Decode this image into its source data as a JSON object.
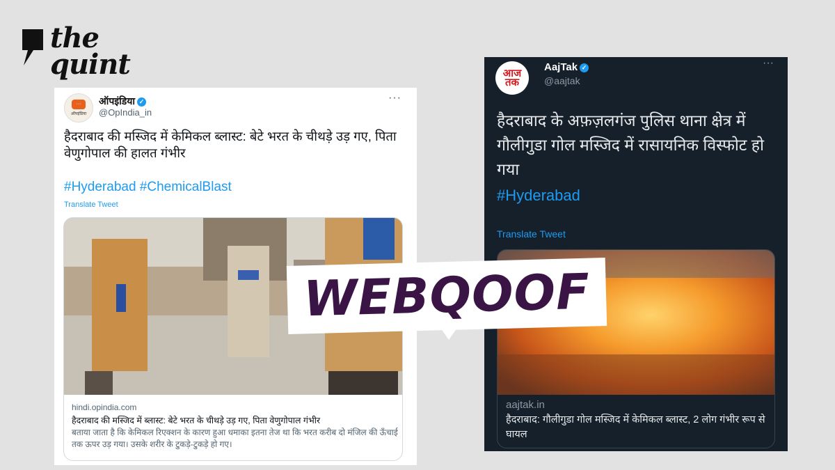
{
  "brand": {
    "line1": "the",
    "line2": "quint"
  },
  "left_tweet": {
    "name": "ऑपइंडिया",
    "handle": "@OpIndia_in",
    "avatar_label": "ऑपइंडिया",
    "text": "हैदराबाद की मस्जिद में केमिकल ब्लास्ट: बेटे भरत के चीथड़े उड़ गए, पिता वेणुगोपाल की हालत गंभीर",
    "hashtags": "#Hyderabad #ChemicalBlast",
    "translate": "Translate Tweet",
    "more": "···",
    "card": {
      "domain": "hindi.opindia.com",
      "title": "हैदराबाद की मस्जिद में ब्लास्ट: बेटे भरत के चीथड़े उड़ गए, पिता वेणुगोपाल गंभीर",
      "description": "बताया जाता है कि केमिकल रिएक्शन के कारण हुआ धमाका इतना तेज था कि भरत करीब दो मंजिल की ऊँचाई तक ऊपर उड़ गया। उसके शरीर के टुकड़े-टुकड़े हो गए।"
    }
  },
  "right_tweet": {
    "name": "AajTak",
    "handle": "@aajtak",
    "avatar_label": "आज तक",
    "text": "हैदराबाद के अफ़ज़लगंज पुलिस थाना क्षेत्र में गौलीगुडा गोल मस्जिद में रासायनिक विस्फोट हो गया",
    "hashtags": "#Hyderabad",
    "translate": "Translate Tweet",
    "more": "···",
    "card": {
      "domain": "aajtak.in",
      "title": "हैदराबाद: गौलीगुडा गोल मस्जिद में केमिकल ब्लास्ट, 2 लोग गंभीर रूप से घायल"
    }
  },
  "banner": {
    "text": "WEBQOOF"
  },
  "colors": {
    "accent": "#1d9bf0",
    "banner_text": "#3a1445",
    "dark_card": "#15202b",
    "aajtak_red": "#d71920"
  }
}
